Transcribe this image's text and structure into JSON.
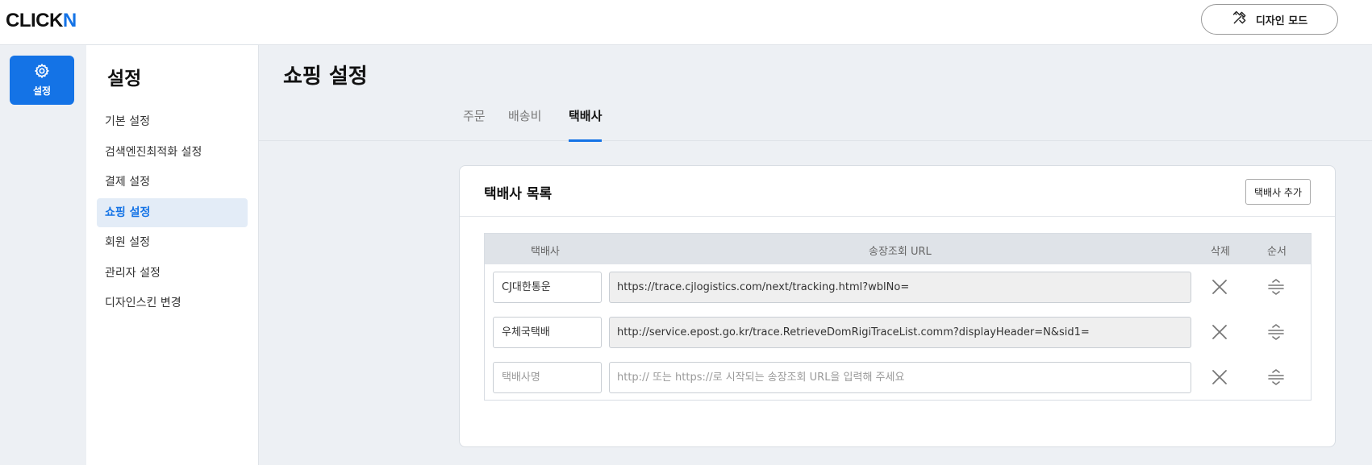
{
  "header": {
    "logo_main": "CLICK",
    "logo_accent": "N",
    "design_mode_label": "디자인 모드",
    "design_mode_icon": "design-tools-icon"
  },
  "rail": {
    "settings_label": "설정",
    "settings_icon": "gear-icon"
  },
  "sidebar": {
    "title": "설정",
    "items": [
      {
        "label": "기본 설정",
        "active": false
      },
      {
        "label": "검색엔진최적화 설정",
        "active": false
      },
      {
        "label": "결제 설정",
        "active": false
      },
      {
        "label": "쇼핑 설정",
        "active": true
      },
      {
        "label": "회원 설정",
        "active": false
      },
      {
        "label": "관리자 설정",
        "active": false
      },
      {
        "label": "디자인스킨 변경",
        "active": false
      }
    ]
  },
  "main": {
    "title": "쇼핑 설정",
    "tabs": [
      {
        "label": "주문",
        "active": false
      },
      {
        "label": "배송비",
        "active": false
      },
      {
        "label": "택배사",
        "active": true
      }
    ],
    "card": {
      "title": "택배사 목록",
      "add_button": "택배사 추가",
      "columns": {
        "courier": "택배사",
        "url": "송장조회 URL",
        "delete": "삭제",
        "order": "순서"
      },
      "rows": [
        {
          "name": "CJ대한통운",
          "url": "https://trace.cjlogistics.com/next/tracking.html?wblNo="
        },
        {
          "name": "우체국택배",
          "url": "http://service.epost.go.kr/trace.RetrieveDomRigiTraceList.comm?displayHeader=N&sid1="
        }
      ],
      "new_row": {
        "name_placeholder": "택배사명",
        "url_placeholder": "http:// 또는 https://로 시작되는 송장조회 URL을 입력해 주세요"
      }
    }
  },
  "colors": {
    "accent": "#1473e6",
    "sidebar_active_bg": "#e3ecf7",
    "table_header_bg": "#dfe3e8"
  }
}
